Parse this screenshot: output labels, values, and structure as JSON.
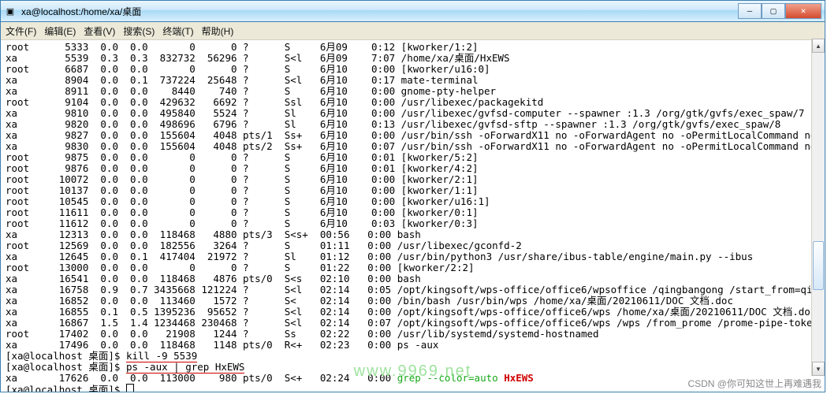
{
  "title": "xa@localhost:/home/xa/桌面",
  "menu": [
    "文件(F)",
    "编辑(E)",
    "查看(V)",
    "搜索(S)",
    "终端(T)",
    "帮助(H)"
  ],
  "cols_widths": [
    6,
    6,
    5,
    5,
    7,
    6,
    6,
    6,
    6,
    6
  ],
  "processes": [
    {
      "user": "root",
      "pid": "5333",
      "c1": "0.0",
      "c2": "0.0",
      "vsz": "0",
      "rss": "0",
      "tty": "?",
      "stat": "S",
      "start": "6月09",
      "time": "0:12",
      "cmd": "[kworker/1:2]"
    },
    {
      "user": "xa",
      "pid": "5539",
      "c1": "0.3",
      "c2": "0.3",
      "vsz": "832732",
      "rss": "56296",
      "tty": "?",
      "stat": "S<l",
      "start": "6月09",
      "time": "7:07",
      "cmd": "/home/xa/桌面/HxEWS"
    },
    {
      "user": "root",
      "pid": "6687",
      "c1": "0.0",
      "c2": "0.0",
      "vsz": "0",
      "rss": "0",
      "tty": "?",
      "stat": "S",
      "start": "6月10",
      "time": "0:00",
      "cmd": "[kworker/u16:0]"
    },
    {
      "user": "xa",
      "pid": "8904",
      "c1": "0.0",
      "c2": "0.1",
      "vsz": "737224",
      "rss": "25648",
      "tty": "?",
      "stat": "S<l",
      "start": "6月10",
      "time": "0:17",
      "cmd": "mate-terminal"
    },
    {
      "user": "xa",
      "pid": "8911",
      "c1": "0.0",
      "c2": "0.0",
      "vsz": "8440",
      "rss": "740",
      "tty": "?",
      "stat": "S",
      "start": "6月10",
      "time": "0:00",
      "cmd": "gnome-pty-helper"
    },
    {
      "user": "root",
      "pid": "9104",
      "c1": "0.0",
      "c2": "0.0",
      "vsz": "429632",
      "rss": "6692",
      "tty": "?",
      "stat": "Ssl",
      "start": "6月10",
      "time": "0:00",
      "cmd": "/usr/libexec/packagekitd"
    },
    {
      "user": "xa",
      "pid": "9810",
      "c1": "0.0",
      "c2": "0.0",
      "vsz": "495840",
      "rss": "5524",
      "tty": "?",
      "stat": "Sl",
      "start": "6月10",
      "time": "0:00",
      "cmd": "/usr/libexec/gvfsd-computer --spawner :1.3 /org/gtk/gvfs/exec_spaw/7"
    },
    {
      "user": "xa",
      "pid": "9820",
      "c1": "0.0",
      "c2": "0.0",
      "vsz": "498696",
      "rss": "6796",
      "tty": "?",
      "stat": "Sl",
      "start": "6月10",
      "time": "0:13",
      "cmd": "/usr/libexec/gvfsd-sftp --spawner :1.3 /org/gtk/gvfs/exec_spaw/8"
    },
    {
      "user": "xa",
      "pid": "9827",
      "c1": "0.0",
      "c2": "0.0",
      "vsz": "155604",
      "rss": "4048",
      "tty": "pts/1",
      "stat": "Ss+",
      "start": "6月10",
      "time": "0:00",
      "cmd": "/usr/bin/ssh -oForwardX11 no -oForwardAgent no -oPermitLocalCommand no -oClearAll"
    },
    {
      "user": "xa",
      "pid": "9830",
      "c1": "0.0",
      "c2": "0.0",
      "vsz": "155604",
      "rss": "4048",
      "tty": "pts/2",
      "stat": "Ss+",
      "start": "6月10",
      "time": "0:07",
      "cmd": "/usr/bin/ssh -oForwardX11 no -oForwardAgent no -oPermitLocalCommand no -oClearAll"
    },
    {
      "user": "root",
      "pid": "9875",
      "c1": "0.0",
      "c2": "0.0",
      "vsz": "0",
      "rss": "0",
      "tty": "?",
      "stat": "S",
      "start": "6月10",
      "time": "0:01",
      "cmd": "[kworker/5:2]"
    },
    {
      "user": "root",
      "pid": "9876",
      "c1": "0.0",
      "c2": "0.0",
      "vsz": "0",
      "rss": "0",
      "tty": "?",
      "stat": "S",
      "start": "6月10",
      "time": "0:01",
      "cmd": "[kworker/4:2]"
    },
    {
      "user": "root",
      "pid": "10072",
      "c1": "0.0",
      "c2": "0.0",
      "vsz": "0",
      "rss": "0",
      "tty": "?",
      "stat": "S",
      "start": "6月10",
      "time": "0:00",
      "cmd": "[kworker/2:1]"
    },
    {
      "user": "root",
      "pid": "10137",
      "c1": "0.0",
      "c2": "0.0",
      "vsz": "0",
      "rss": "0",
      "tty": "?",
      "stat": "S",
      "start": "6月10",
      "time": "0:00",
      "cmd": "[kworker/1:1]"
    },
    {
      "user": "root",
      "pid": "10545",
      "c1": "0.0",
      "c2": "0.0",
      "vsz": "0",
      "rss": "0",
      "tty": "?",
      "stat": "S",
      "start": "6月10",
      "time": "0:00",
      "cmd": "[kworker/u16:1]"
    },
    {
      "user": "root",
      "pid": "11611",
      "c1": "0.0",
      "c2": "0.0",
      "vsz": "0",
      "rss": "0",
      "tty": "?",
      "stat": "S",
      "start": "6月10",
      "time": "0:00",
      "cmd": "[kworker/0:1]"
    },
    {
      "user": "root",
      "pid": "11612",
      "c1": "0.0",
      "c2": "0.0",
      "vsz": "0",
      "rss": "0",
      "tty": "?",
      "stat": "S",
      "start": "6月10",
      "time": "0:03",
      "cmd": "[kworker/0:3]"
    },
    {
      "user": "xa",
      "pid": "12313",
      "c1": "0.0",
      "c2": "0.0",
      "vsz": "118468",
      "rss": "4880",
      "tty": "pts/3",
      "stat": "S<s+",
      "start": "00:56",
      "time": "0:00",
      "cmd": "bash"
    },
    {
      "user": "root",
      "pid": "12569",
      "c1": "0.0",
      "c2": "0.0",
      "vsz": "182556",
      "rss": "3264",
      "tty": "?",
      "stat": "S",
      "start": "01:11",
      "time": "0:00",
      "cmd": "/usr/libexec/gconfd-2"
    },
    {
      "user": "xa",
      "pid": "12645",
      "c1": "0.0",
      "c2": "0.1",
      "vsz": "417404",
      "rss": "21972",
      "tty": "?",
      "stat": "Sl",
      "start": "01:12",
      "time": "0:00",
      "cmd": "/usr/bin/python3 /usr/share/ibus-table/engine/main.py --ibus"
    },
    {
      "user": "root",
      "pid": "13000",
      "c1": "0.0",
      "c2": "0.0",
      "vsz": "0",
      "rss": "0",
      "tty": "?",
      "stat": "S",
      "start": "01:22",
      "time": "0:00",
      "cmd": "[kworker/2:2]"
    },
    {
      "user": "xa",
      "pid": "16541",
      "c1": "0.0",
      "c2": "0.0",
      "vsz": "118468",
      "rss": "4876",
      "tty": "pts/0",
      "stat": "S<s",
      "start": "02:10",
      "time": "0:00",
      "cmd": "bash"
    },
    {
      "user": "xa",
      "pid": "16758",
      "c1": "0.9",
      "c2": "0.7",
      "vsz": "3435668",
      "rss": "121224",
      "tty": "?",
      "stat": "S<l",
      "start": "02:14",
      "time": "0:05",
      "cmd": "/opt/kingsoft/wps-office/office6/wpsoffice /qingbangong /start_from=qingipc autol"
    },
    {
      "user": "xa",
      "pid": "16852",
      "c1": "0.0",
      "c2": "0.0",
      "vsz": "113460",
      "rss": "1572",
      "tty": "?",
      "stat": "S<",
      "start": "02:14",
      "time": "0:00",
      "cmd": "/bin/bash /usr/bin/wps /home/xa/桌面/20210611/DOC 文档.doc"
    },
    {
      "user": "xa",
      "pid": "16855",
      "c1": "0.1",
      "c2": "0.5",
      "vsz": "1395236",
      "rss": "95652",
      "tty": "?",
      "stat": "S<l",
      "start": "02:14",
      "time": "0:00",
      "cmd": "/opt/kingsoft/wps-office/office6/wps /home/xa/桌面/20210611/DOC 文档.doc"
    },
    {
      "user": "xa",
      "pid": "16867",
      "c1": "1.5",
      "c2": "1.4",
      "vsz": "1234468",
      "rss": "230468",
      "tty": "?",
      "stat": "S<l",
      "start": "02:14",
      "time": "0:07",
      "cmd": "/opt/kingsoft/wps-office/office6/wps /wps /from_prome /prome-pipe-token=kpromethe"
    },
    {
      "user": "root",
      "pid": "17402",
      "c1": "0.0",
      "c2": "0.0",
      "vsz": "21908",
      "rss": "1244",
      "tty": "?",
      "stat": "Ss",
      "start": "02:22",
      "time": "0:00",
      "cmd": "/usr/lib/systemd/systemd-hostnamed"
    },
    {
      "user": "xa",
      "pid": "17496",
      "c1": "0.0",
      "c2": "0.0",
      "vsz": "118468",
      "rss": "1148",
      "tty": "pts/0",
      "stat": "R<+",
      "start": "02:23",
      "time": "0:00",
      "cmd": "ps -aux"
    }
  ],
  "prompt1": {
    "prefix": "[xa@localhost 桌面]$ ",
    "cmd": "kill -9 5539"
  },
  "prompt2": {
    "prefix": "[xa@localhost 桌面]$ ",
    "cmd": "ps -aux | grep HxEWS"
  },
  "grep_line": {
    "user": "xa",
    "pid": "17626",
    "c1": "0.0",
    "c2": "0.0",
    "vsz": "113000",
    "rss": "980",
    "tty": "pts/0",
    "stat": "S<+",
    "start": "02:24",
    "time": "0:00",
    "cmd_pre": "grep ",
    "flag": "--color=auto",
    "sp": " ",
    "match": "HxEWS"
  },
  "prompt3": {
    "prefix": "[xa@localhost 桌面]$ "
  },
  "watermark": "www.9969.net",
  "footer": "CSDN @你可知这世上再难遇我",
  "winbtns": {
    "min": "─",
    "max": "▢",
    "close": "✕"
  }
}
